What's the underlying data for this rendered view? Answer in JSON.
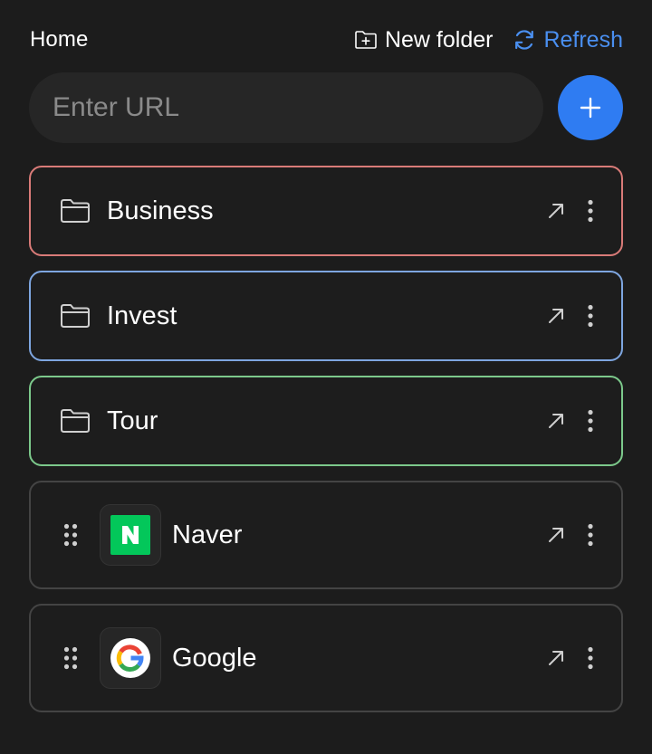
{
  "header": {
    "breadcrumb": "Home",
    "new_folder_label": "New folder",
    "refresh_label": "Refresh"
  },
  "url_input": {
    "placeholder": "Enter URL",
    "value": ""
  },
  "colors": {
    "accent": "#2f7cf2",
    "refresh": "#4a8ff0",
    "folder_business": "#d97b78",
    "folder_invest": "#7ea6e0",
    "folder_tour": "#7cc98b",
    "naver_green": "#03c75a"
  },
  "folders": [
    {
      "label": "Business",
      "icon": "folder-icon",
      "border_color": "#d97b78"
    },
    {
      "label": "Invest",
      "icon": "folder-icon",
      "border_color": "#7ea6e0"
    },
    {
      "label": "Tour",
      "icon": "folder-icon",
      "border_color": "#7cc98b"
    }
  ],
  "links": [
    {
      "label": "Naver",
      "icon": "naver-logo-icon"
    },
    {
      "label": "Google",
      "icon": "google-logo-icon"
    }
  ]
}
